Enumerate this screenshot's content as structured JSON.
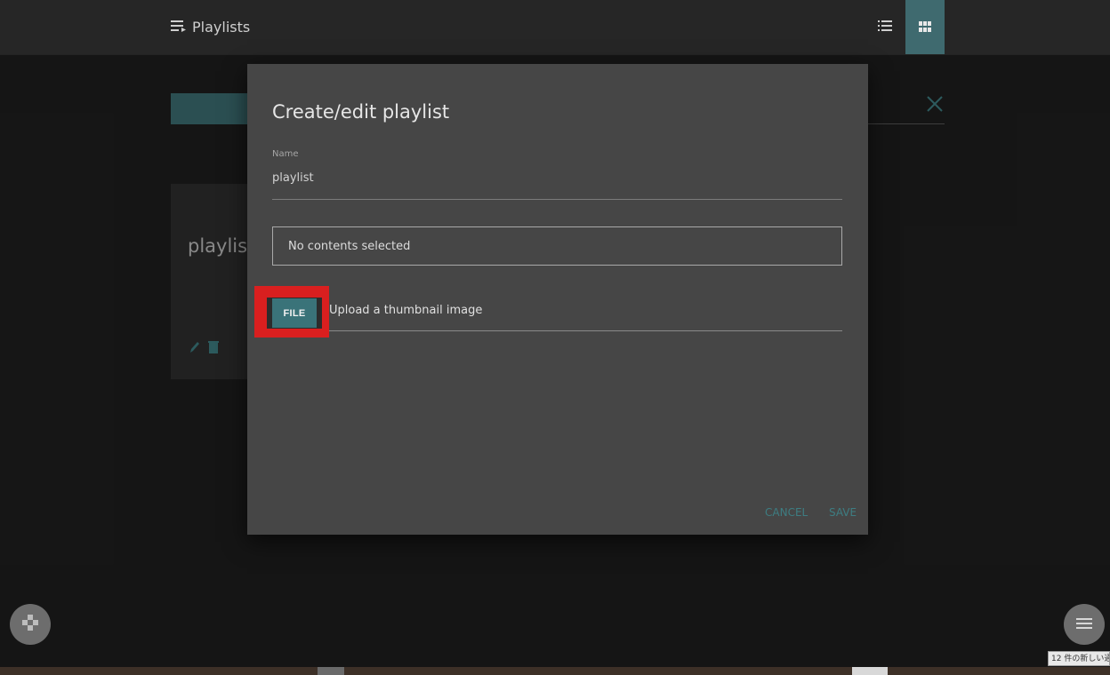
{
  "header": {
    "title": "Playlists",
    "icons": {
      "title": "playlist-icon",
      "list_view": "list-view-icon",
      "grid_view": "grid-view-icon"
    }
  },
  "background": {
    "card_title": "playlist"
  },
  "dialog": {
    "title": "Create/edit playlist",
    "name_label": "Name",
    "name_value": "playlist",
    "contents_placeholder": "No contents selected",
    "file_button_label": "FILE",
    "upload_label": "Upload a thumbnail image",
    "cancel_label": "CANCEL",
    "save_label": "SAVE"
  },
  "fab": {
    "left_icon": "gamepad-icon",
    "right_icon": "menu-icon"
  },
  "taskbar": {
    "notification": "12 件の新しい通"
  },
  "colors": {
    "accent": "#3a7379",
    "highlight": "#d91f1f",
    "dialog_bg": "#464646",
    "page_bg": "#1e1e1e"
  }
}
